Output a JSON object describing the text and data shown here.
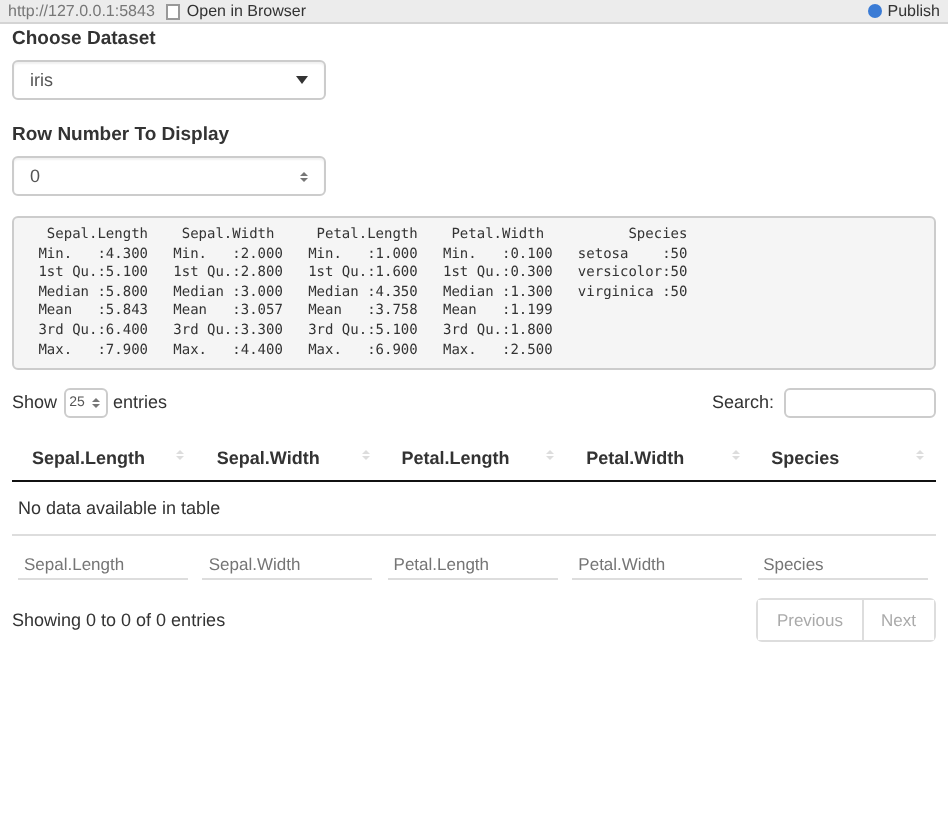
{
  "toolbar": {
    "url": "http://127.0.0.1:5843",
    "open_button": "Open in Browser",
    "publish_button": "Publish"
  },
  "dataset_select": {
    "label": "Choose Dataset",
    "value": "iris"
  },
  "row_number_input": {
    "label": "Row Number To Display",
    "value": "0"
  },
  "summary_output": [
    "  Sepal.Length    Sepal.Width     Petal.Length    Petal.Width          Species  ",
    " Min.   :4.300   Min.   :2.000   Min.   :1.000   Min.   :0.100   setosa    :50  ",
    " 1st Qu.:5.100   1st Qu.:2.800   1st Qu.:1.600   1st Qu.:0.300   versicolor:50  ",
    " Median :5.800   Median :3.000   Median :4.350   Median :1.300   virginica :50  ",
    " Mean   :5.843   Mean   :3.057   Mean   :3.758   Mean   :1.199                  ",
    " 3rd Qu.:6.400   3rd Qu.:3.300   3rd Qu.:5.100   3rd Qu.:1.800                  ",
    " Max.   :7.900   Max.   :4.400   Max.   :6.900   Max.   :2.500                  "
  ],
  "table": {
    "show_label": "Show",
    "page_length": "25",
    "entries_label": "entries",
    "search_label": "Search:",
    "columns": [
      "Sepal.Length",
      "Sepal.Width",
      "Petal.Length",
      "Petal.Width",
      "Species"
    ],
    "empty_message": "No data available in table",
    "filters": [
      {
        "placeholder": "Sepal.Length"
      },
      {
        "placeholder": "Sepal.Width"
      },
      {
        "placeholder": "Petal.Length"
      },
      {
        "placeholder": "Petal.Width"
      },
      {
        "placeholder": "Species"
      }
    ],
    "info": "Showing 0 to 0 of 0 entries",
    "pagination": [
      {
        "label": "Previous",
        "disabled": true
      },
      {
        "label": "Next",
        "disabled": true
      }
    ]
  }
}
